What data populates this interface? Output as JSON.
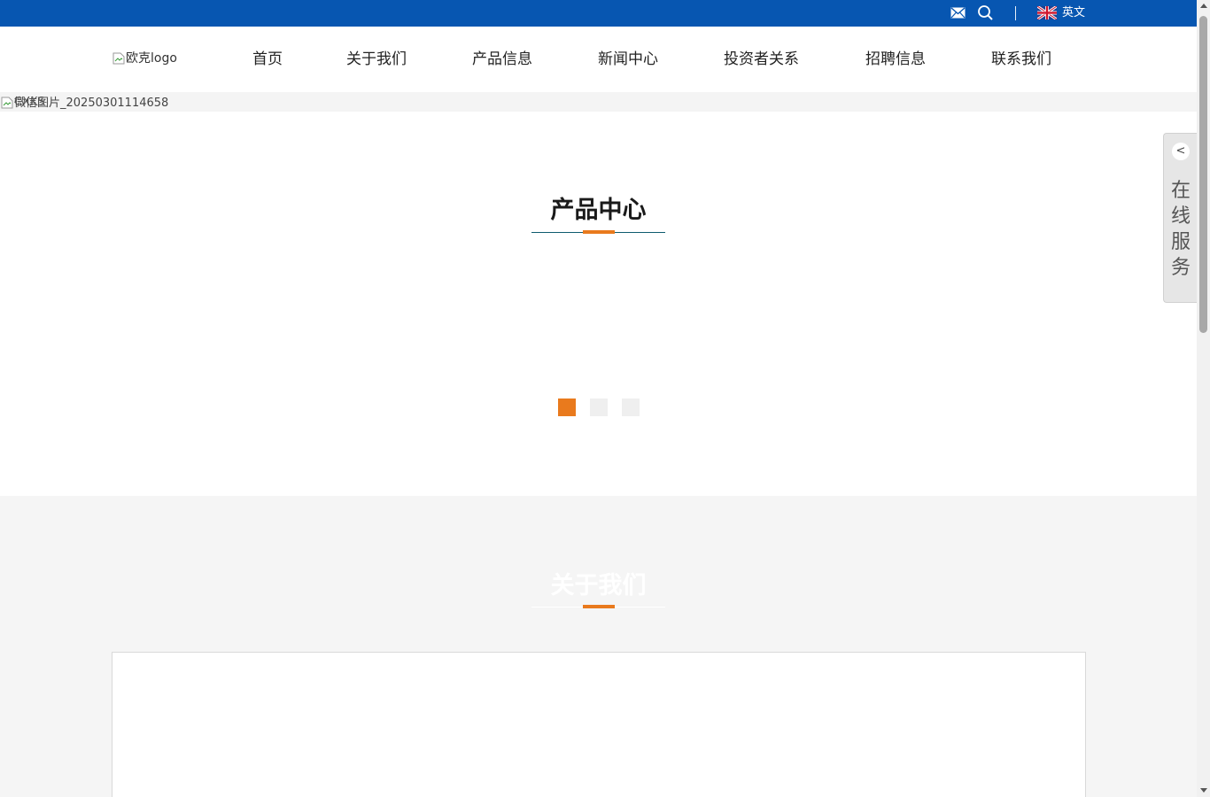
{
  "colors": {
    "topbar": "#0756b1",
    "accent": "#e97a1d",
    "title_line": "#0e5c6f",
    "about_bg": "#f5f5f5"
  },
  "topbar": {
    "mail_icon": "mail-icon",
    "search_icon": "search-icon",
    "flag_icon": "uk-flag-icon",
    "language_label": "英文"
  },
  "header": {
    "logo_alt": "欧克logo",
    "nav": [
      "首页",
      "关于我们",
      "产品信息",
      "新闻中心",
      "投资者关系",
      "招聘信息",
      "联系我们"
    ]
  },
  "banner": {
    "image_alt": "微信图片_20250301114658",
    "image_alt_overlap": "CXKS"
  },
  "products": {
    "title": "产品中心",
    "slide_count": 3,
    "active_slide": 1
  },
  "about": {
    "title": "关于我们"
  },
  "service": {
    "toggle_label": "<",
    "label": "在线服务"
  }
}
